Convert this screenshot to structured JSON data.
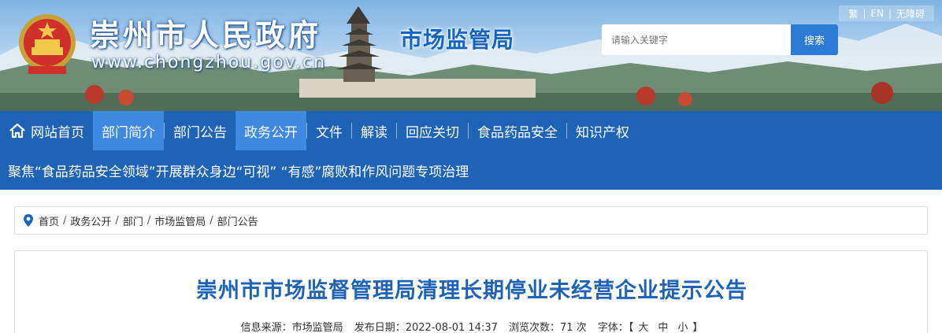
{
  "header": {
    "site_title": "崇州市人民政府",
    "site_url": "www.chongzhou.gov.cn",
    "dept_name": "市场监管局",
    "top_links": [
      "繁",
      "EN",
      "无障碍"
    ],
    "search": {
      "placeholder": "请输入关键字",
      "button_label": "搜索"
    },
    "colors": {
      "nav": "#1f63b6",
      "nav_active": "#3f8ae0",
      "title": "#1f63b6"
    }
  },
  "nav": {
    "items": [
      {
        "label": "网站首页",
        "icon": "home-icon",
        "active": false
      },
      {
        "label": "部门简介",
        "active": true
      },
      {
        "label": "部门公告",
        "active": false
      },
      {
        "label": "政务公开",
        "active": true
      },
      {
        "label": "文件",
        "active": false
      },
      {
        "label": "解读",
        "active": false
      },
      {
        "label": "回应关切",
        "active": false
      },
      {
        "label": "食品药品安全",
        "active": false
      },
      {
        "label": "知识产权",
        "active": false
      }
    ]
  },
  "ticker": {
    "text": "聚焦“食品药品安全领域”开展群众身边“可视” “有感”腐败和作风问题专项治理"
  },
  "breadcrumb": {
    "icon": "location-pin-icon",
    "items": [
      "首页",
      "政务公开",
      "部门",
      "市场监管局",
      "部门公告"
    ],
    "separator": "/"
  },
  "article": {
    "title": "崇州市市场监督管理局清理长期停业未经营企业提示公告",
    "source_label": "信息来源：市场监管局",
    "date_label": "发布日期：2022-08-01 14:37",
    "views_label": "浏览次数：71 次",
    "font_label": "字体：",
    "font_open": "【",
    "font_sizes": [
      "大",
      "中",
      "小"
    ],
    "font_close": "】"
  }
}
